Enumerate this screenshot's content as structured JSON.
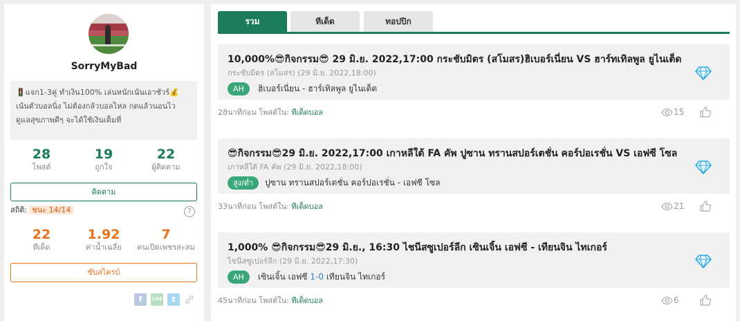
{
  "profile": {
    "username": "SorryMyBad",
    "bio_line1": "แจก1-3คู่ ทำเงิน100% เล่นหนักเน้นเอาชัวร์",
    "bio_line2": "เน้นตัวบอลนิ่ง ไม่ต้องกลัวบอลไหล กดแล้วนอนไว",
    "bio_line3": "ดูแลสุขภาพดีๆ จะได้ใช้เงินเต็มที่",
    "stats": [
      {
        "value": "28",
        "label": "โพสต์"
      },
      {
        "value": "19",
        "label": "ถูกใจ"
      },
      {
        "value": "22",
        "label": "ผู้ติดตาม"
      }
    ],
    "follow_label": "ติดตาม",
    "stati_label": "สถิติ:",
    "stati_badge": "ชนะ 14/14",
    "help_label": "?",
    "tip_stats": [
      {
        "value": "22",
        "label": "ทีเด็ด"
      },
      {
        "value": "1.92",
        "label": "ค่าน้ำเฉลี่ย"
      },
      {
        "value": "7",
        "label": "คนเปิดเพชรสะสม"
      }
    ],
    "subscribe_label": "ซับสไครบ์",
    "share": {
      "facebook": "f",
      "line": "LINE",
      "twitter": "t"
    }
  },
  "tabs": [
    {
      "label": "รวม",
      "active": true
    },
    {
      "label": "ทีเด็ด",
      "active": false
    },
    {
      "label": "ทอปปิก",
      "active": false
    }
  ],
  "posts": [
    {
      "title": "10,000%😎กิจกรรม😎 29 มิ.ย. 2022,17:00 กระชับมิตร (สโมสร)ฮิเบอร์เนี่ยน VS ฮาร์ทเทิลพูล ยูไนเต็ด",
      "league": "กระชับมิตร (สโมสร) (29 มิ.ย. 2022,18:00)",
      "tag": "AH",
      "match_home": "ฮิเบอร์เนี่ยน",
      "match_sep": " - ",
      "match_score": "",
      "match_away": "ฮาร์เทิลพูล ยูไนเต็ด",
      "time": "28นาทีก่อน",
      "posted_in": "โพสต์ใน:",
      "category": "ทีเด็ดบอล",
      "views": "15"
    },
    {
      "title": "😎กิจกรรม😎29 มิ.ย. 2022,17:00 เกาหลีใต้ FA คัพ ปูซาน ทรานสปอร์เตชั่น คอร์ปอเรชั่น VS เอฟซี โซล",
      "league": "เกาหลีใต้ FA คัพ (29 มิ.ย. 2022,18:00)",
      "tag": "สูง/ต่ำ",
      "match_home": "ปูซาน ทรานสปอร์เตชั่น คอร์ปอเรชั่น",
      "match_sep": " - ",
      "match_score": "",
      "match_away": "เอฟซี โซล",
      "time": "33นาทีก่อน",
      "posted_in": "โพสต์ใน:",
      "category": "ทีเด็ดบอล",
      "views": "21"
    },
    {
      "title": "1,000% 😎กิจกรรม😎29 มิ.ย., 16:30 ไชนีสซูเปอร์ลีก เซินเจิ้น เอฟซี - เทียนจิน ไทเกอร์",
      "league": "ไชนีสซูเปอร์ลีก (29 มิ.ย. 2022,17:30)",
      "tag": "AH",
      "match_home": "เซินเจิ้น เอฟซี",
      "match_sep": " ",
      "match_score": "1-0",
      "match_away": "เทียนจิน ไทเกอร์",
      "time": "45นาทีก่อน",
      "posted_in": "โพสต์ใน:",
      "category": "ทีเด็ดบอล",
      "views": "6"
    }
  ],
  "colors": {
    "green": "#1a7c58",
    "orange": "#e8731c",
    "tag": "#3aa77a",
    "diamond": "#29a8e0"
  }
}
